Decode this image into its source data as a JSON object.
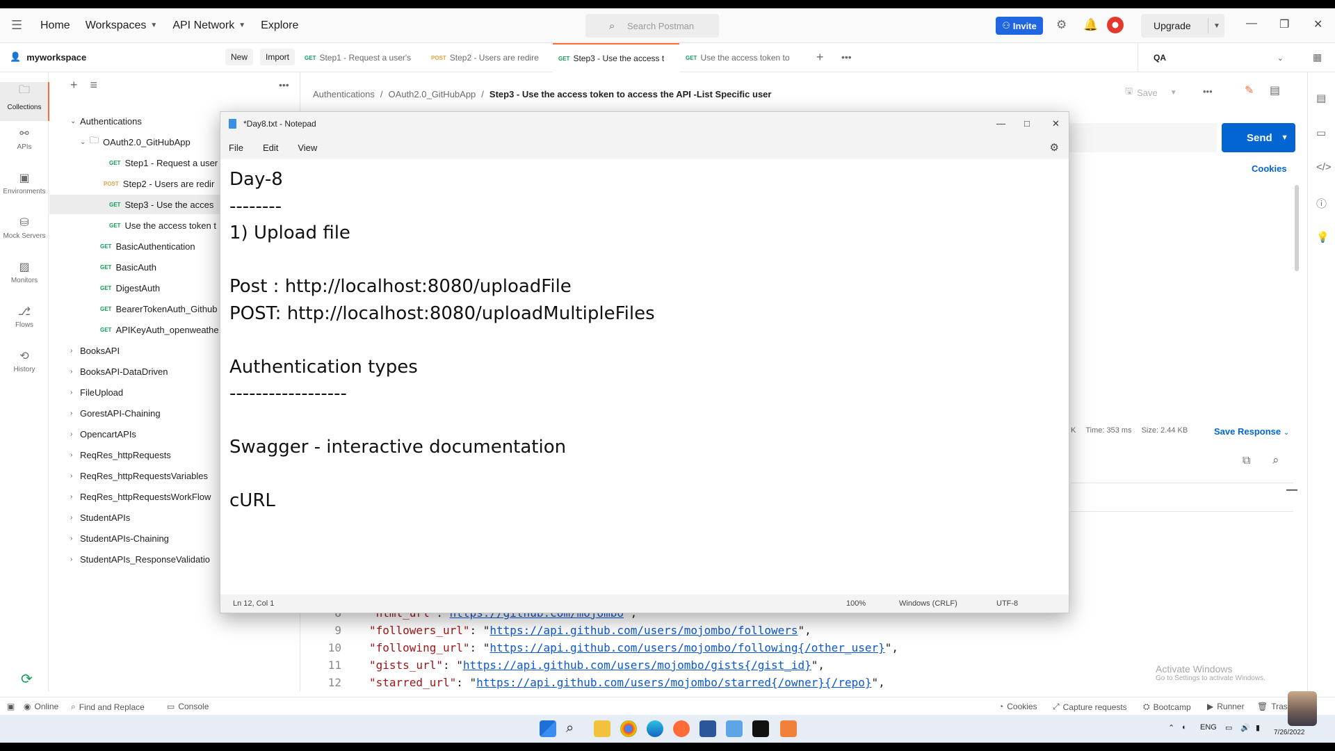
{
  "topbar": {
    "nav": [
      "Home",
      "Workspaces",
      "API Network",
      "Explore"
    ],
    "search_placeholder": "Search Postman",
    "invite_label": "Invite",
    "upgrade_label": "Upgrade"
  },
  "workspace": {
    "name": "myworkspace",
    "new_label": "New",
    "import_label": "Import"
  },
  "tabs": [
    {
      "method": "GET",
      "label": "Step1 - Request a user's"
    },
    {
      "method": "POST",
      "label": "Step2 - Users are redire"
    },
    {
      "method": "GET",
      "label": "Step3 - Use the access t"
    },
    {
      "method": "GET",
      "label": "Use the access token to"
    }
  ],
  "environment": "QA",
  "rail": [
    {
      "label": "Collections",
      "icon": "collections-icon"
    },
    {
      "label": "APIs",
      "icon": "apis-icon"
    },
    {
      "label": "Environments",
      "icon": "environments-icon"
    },
    {
      "label": "Mock Servers",
      "icon": "mock-servers-icon"
    },
    {
      "label": "Monitors",
      "icon": "monitors-icon"
    },
    {
      "label": "Flows",
      "icon": "flows-icon"
    },
    {
      "label": "History",
      "icon": "history-icon"
    }
  ],
  "tree": [
    {
      "label": "Authentications",
      "method": ""
    },
    {
      "label": "OAuth2.0_GitHubApp",
      "method": ""
    },
    {
      "label": "Step1 - Request a user",
      "method": "GET"
    },
    {
      "label": "Step2 - Users are redir",
      "method": "POST"
    },
    {
      "label": "Step3 - Use the acces",
      "method": "GET"
    },
    {
      "label": "Use the access token t",
      "method": "GET"
    },
    {
      "label": "BasicAuthentication",
      "method": "GET"
    },
    {
      "label": "BasicAuth",
      "method": "GET"
    },
    {
      "label": "DigestAuth",
      "method": "GET"
    },
    {
      "label": "BearerTokenAuth_Github",
      "method": "GET"
    },
    {
      "label": "APIKeyAuth_openweathe",
      "method": "GET"
    },
    {
      "label": "BooksAPI",
      "method": ""
    },
    {
      "label": "BooksAPI-DataDriven",
      "method": ""
    },
    {
      "label": "FileUpload",
      "method": ""
    },
    {
      "label": "GorestAPI-Chaining",
      "method": ""
    },
    {
      "label": "OpencartAPIs",
      "method": ""
    },
    {
      "label": "ReqRes_httpRequests",
      "method": ""
    },
    {
      "label": "ReqRes_httpRequestsVariables",
      "method": ""
    },
    {
      "label": "ReqRes_httpRequestsWorkFlow",
      "method": ""
    },
    {
      "label": "StudentAPIs",
      "method": ""
    },
    {
      "label": "StudentAPIs-Chaining",
      "method": ""
    },
    {
      "label": "StudentAPIs_ResponseValidatio",
      "method": ""
    }
  ],
  "breadcrumb": {
    "part1": "Authentications",
    "part2": "OAuth2.0_GitHubApp",
    "current": "Step3 - Use the access token to access the API -List Specific user"
  },
  "request": {
    "save_label": "Save",
    "send_label": "Send",
    "cookies_label": "Cookies"
  },
  "response": {
    "status_fragment": "K",
    "time": "Time: 353 ms",
    "size": "Size: 2.44 KB",
    "save_response_label": "Save Response"
  },
  "code_lines": [
    {
      "ln": "8",
      "key": "\"html_url\"",
      "sep": ": ",
      "url": "https://github.com/mojombo",
      "tail": "\","
    },
    {
      "ln": "9",
      "key": "\"followers_url\"",
      "sep": ": \"",
      "url": "https://api.github.com/users/mojombo/followers",
      "tail": "\","
    },
    {
      "ln": "10",
      "key": "\"following_url\"",
      "sep": ": \"",
      "url": "https://api.github.com/users/mojombo/following{/other_user}",
      "tail": "\","
    },
    {
      "ln": "11",
      "key": "\"gists_url\"",
      "sep": ": \"",
      "url": "https://api.github.com/users/mojombo/gists{/gist_id}",
      "tail": "\","
    },
    {
      "ln": "12",
      "key": "\"starred_url\"",
      "sep": ": \"",
      "url": "https://api.github.com/users/mojombo/starred{/owner}{/repo}",
      "tail": "\","
    }
  ],
  "watermark": {
    "title": "Activate Windows",
    "sub": "Go to Settings to activate Windows."
  },
  "statusbar": {
    "online": "Online",
    "find_replace": "Find and Replace",
    "console": "Console",
    "cookies": "Cookies",
    "capture": "Capture requests",
    "bootcamp": "Bootcamp",
    "runner": "Runner",
    "trash": "Trash"
  },
  "notepad": {
    "title": "*Day8.txt - Notepad",
    "menu": [
      "File",
      "Edit",
      "View"
    ],
    "content": "Day-8\n--------\n1) Upload file\n\nPost : http://localhost:8080/uploadFile\nPOST: http://localhost:8080/uploadMultipleFiles\n\nAuthentication types\n------------------\n\nSwagger - interactive documentation\n\ncURL",
    "status": {
      "position": "Ln 12, Col 1",
      "zoom": "100%",
      "eol": "Windows (CRLF)",
      "encoding": "UTF-8"
    }
  },
  "taskbar": {
    "lang": "ENG",
    "date": "7/26/2022"
  }
}
